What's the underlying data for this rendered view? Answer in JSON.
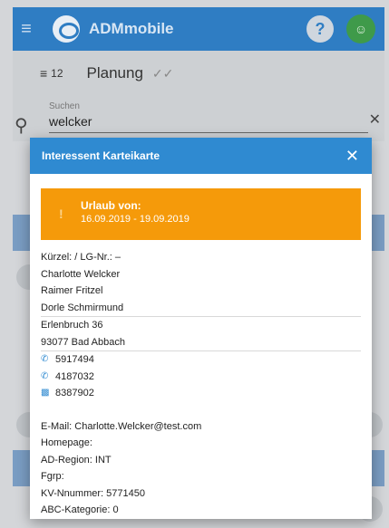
{
  "app": {
    "title": "ADMmobile"
  },
  "subbar": {
    "count": "12",
    "title": "Planung"
  },
  "search": {
    "label": "Suchen",
    "value": "welcker"
  },
  "modal": {
    "title": "Interessent Karteikarte",
    "alert": {
      "title": "Urlaub von:",
      "dates": "16.09.2019 - 19.09.2019"
    },
    "kuerzel": "Kürzel: / LG-Nr.: –",
    "names": [
      "Charlotte Welcker",
      "Raimer Fritzel",
      "Dorle Schmirmund"
    ],
    "address": {
      "street": "Erlenbruch 36",
      "city": "93077 Bad Abbach"
    },
    "contacts": {
      "phone": "5917494",
      "mobile": "4187032",
      "fax": "8387902"
    },
    "details": {
      "email": "E-Mail: Charlotte.Welcker@test.com",
      "homepage": "Homepage:",
      "region": "AD-Region: INT",
      "fgrp": "Fgrp:",
      "kv": "KV-Nnummer: 5771450",
      "abc": "ABC-Kategorie: 0"
    }
  },
  "colors": {
    "primary": "#2f8ad1",
    "alert": "#f59a0a",
    "user": "#3f9a4a"
  },
  "icons": {
    "menu": "menu-icon",
    "help": "help-icon",
    "user": "user-icon",
    "search": "search-icon",
    "close": "close-icon",
    "phone": "phone-icon",
    "mobile": "phone-forward-icon",
    "fax": "fax-icon",
    "alert": "exclamation-icon"
  }
}
